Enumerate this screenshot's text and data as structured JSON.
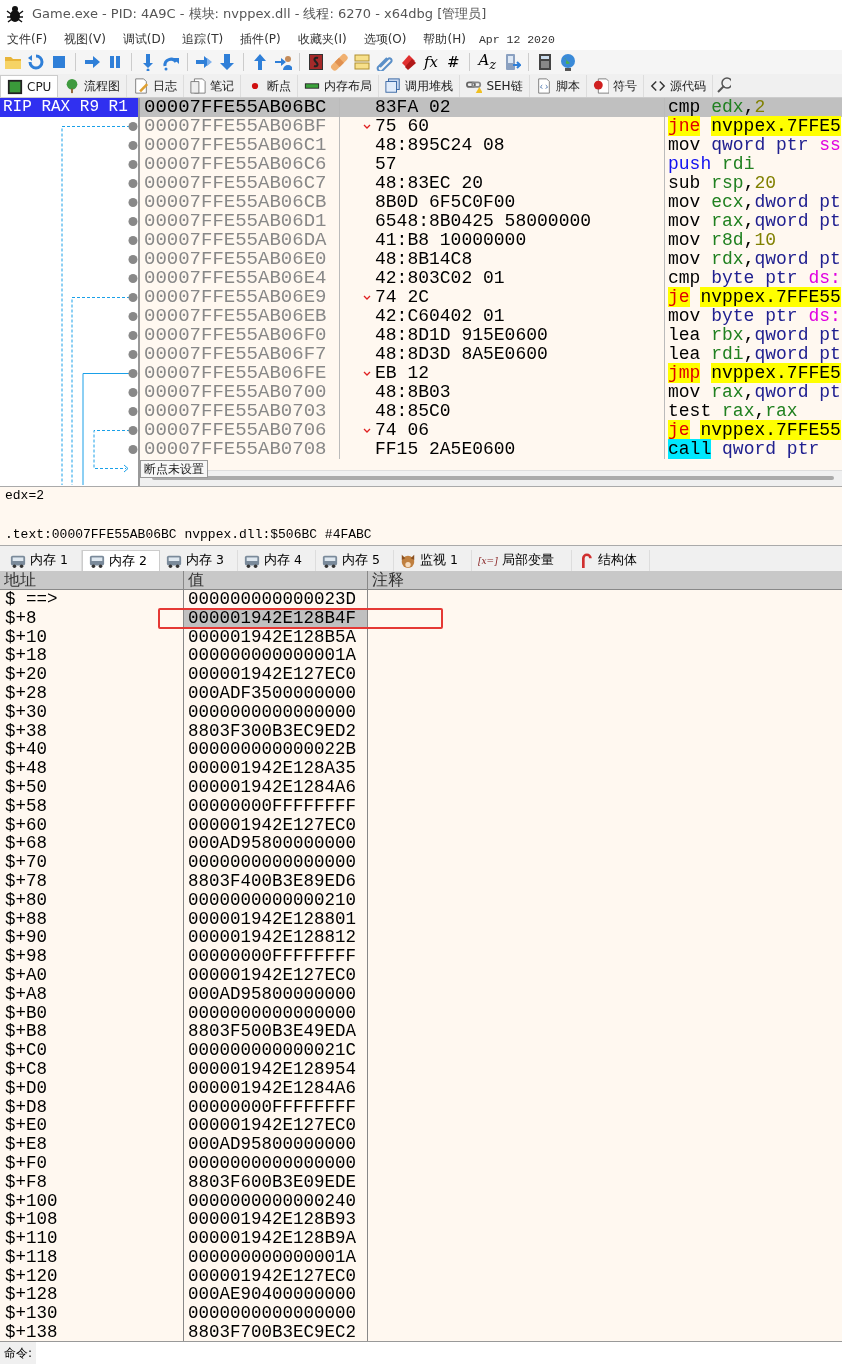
{
  "window": {
    "title": "Game.exe - PID: 4A9C - 模块: nvppex.dll - 线程: 6270 - x64dbg [管理员]"
  },
  "menu": [
    "文件(F)",
    "视图(V)",
    "调试(D)",
    "追踪(T)",
    "插件(P)",
    "收藏夹(I)",
    "选项(O)",
    "帮助(H)"
  ],
  "build_date": "Apr 12 2020",
  "toolbar": [
    {
      "kind": "folder"
    },
    {
      "kind": "restart"
    },
    {
      "kind": "stop"
    },
    {
      "kind": "separator"
    },
    {
      "kind": "run"
    },
    {
      "kind": "pause"
    },
    {
      "kind": "separator"
    },
    {
      "kind": "step-into"
    },
    {
      "kind": "step-over"
    },
    {
      "kind": "separator"
    },
    {
      "kind": "trace-into"
    },
    {
      "kind": "trace-over"
    },
    {
      "kind": "separator"
    },
    {
      "kind": "run-return"
    },
    {
      "kind": "run-user"
    },
    {
      "kind": "separator"
    },
    {
      "kind": "script"
    },
    {
      "kind": "patch"
    },
    {
      "kind": "comment"
    },
    {
      "kind": "link"
    },
    {
      "kind": "bookmark"
    },
    {
      "kind": "glyph",
      "text": "fx"
    },
    {
      "kind": "glyph",
      "text": "#"
    },
    {
      "kind": "separator"
    },
    {
      "kind": "glyph",
      "text": "A$_{z}$"
    },
    {
      "kind": "device"
    },
    {
      "kind": "separator"
    },
    {
      "kind": "calculator"
    },
    {
      "kind": "globe"
    }
  ],
  "tabs": [
    {
      "label": "CPU",
      "kind": "chip",
      "selected": true
    },
    {
      "label": "流程图",
      "kind": "tree",
      "selected": false
    },
    {
      "label": "日志",
      "kind": "log",
      "selected": false
    },
    {
      "label": "笔记",
      "kind": "notes",
      "selected": false
    },
    {
      "label": "断点",
      "kind": "dot",
      "selected": false
    },
    {
      "label": "内存布局",
      "kind": "ram",
      "selected": false
    },
    {
      "label": "调用堆栈",
      "kind": "stack",
      "selected": false
    },
    {
      "label": "SEH链",
      "kind": "chain",
      "selected": false
    },
    {
      "label": "脚本",
      "kind": "script",
      "selected": false
    },
    {
      "label": "符号",
      "kind": "symbol",
      "selected": false
    },
    {
      "label": "源代码",
      "kind": "code",
      "selected": false
    }
  ],
  "registers_header": "RIP RAX R9 R1",
  "disassembly": [
    {
      "address": "00007FFE55AB06BC",
      "bytes": "83FA 02",
      "branch": false,
      "selected": true,
      "mnemonic": "cmp",
      "kind": "plain",
      "operands": [
        {
          "text": "edx",
          "kind": "reg"
        },
        {
          "text": ",",
          "kind": "plain"
        },
        {
          "text": "2",
          "kind": "num"
        }
      ]
    },
    {
      "address": "00007FFE55AB06BF",
      "bytes": "75 60",
      "branch": true,
      "selected": false,
      "mnemonic": "jne",
      "kind": "jump",
      "operands": [
        {
          "text": "nvppex.7FFE5",
          "kind": "target"
        }
      ]
    },
    {
      "address": "00007FFE55AB06C1",
      "bytes": "48:895C24 08",
      "branch": false,
      "selected": false,
      "mnemonic": "mov",
      "kind": "plain",
      "operands": [
        {
          "text": "qword ptr ",
          "kind": "size"
        },
        {
          "text": "ss",
          "kind": "seg"
        }
      ]
    },
    {
      "address": "00007FFE55AB06C6",
      "bytes": "57",
      "branch": false,
      "selected": false,
      "mnemonic": "push",
      "kind": "push",
      "operands": [
        {
          "text": "rdi",
          "kind": "reg"
        }
      ]
    },
    {
      "address": "00007FFE55AB06C7",
      "bytes": "48:83EC 20",
      "branch": false,
      "selected": false,
      "mnemonic": "sub",
      "kind": "plain",
      "operands": [
        {
          "text": "rsp",
          "kind": "reg"
        },
        {
          "text": ",",
          "kind": "plain"
        },
        {
          "text": "20",
          "kind": "num"
        }
      ]
    },
    {
      "address": "00007FFE55AB06CB",
      "bytes": "8B0D 6F5C0F00",
      "branch": false,
      "selected": false,
      "mnemonic": "mov",
      "kind": "plain",
      "operands": [
        {
          "text": "ecx",
          "kind": "reg"
        },
        {
          "text": ",",
          "kind": "plain"
        },
        {
          "text": "dword pt",
          "kind": "size"
        }
      ]
    },
    {
      "address": "00007FFE55AB06D1",
      "bytes": "6548:8B0425 58000000",
      "branch": false,
      "selected": false,
      "mnemonic": "mov",
      "kind": "plain",
      "operands": [
        {
          "text": "rax",
          "kind": "reg"
        },
        {
          "text": ",",
          "kind": "plain"
        },
        {
          "text": "qword pt",
          "kind": "size"
        }
      ]
    },
    {
      "address": "00007FFE55AB06DA",
      "bytes": "41:B8 10000000",
      "branch": false,
      "selected": false,
      "mnemonic": "mov",
      "kind": "plain",
      "operands": [
        {
          "text": "r8d",
          "kind": "reg"
        },
        {
          "text": ",",
          "kind": "plain"
        },
        {
          "text": "10",
          "kind": "num"
        }
      ]
    },
    {
      "address": "00007FFE55AB06E0",
      "bytes": "48:8B14C8",
      "branch": false,
      "selected": false,
      "mnemonic": "mov",
      "kind": "plain",
      "operands": [
        {
          "text": "rdx",
          "kind": "reg"
        },
        {
          "text": ",",
          "kind": "plain"
        },
        {
          "text": "qword pt",
          "kind": "size"
        }
      ]
    },
    {
      "address": "00007FFE55AB06E4",
      "bytes": "42:803C02 01",
      "branch": false,
      "selected": false,
      "mnemonic": "cmp",
      "kind": "plain",
      "operands": [
        {
          "text": "byte ptr ",
          "kind": "size"
        },
        {
          "text": "ds:",
          "kind": "seg"
        }
      ]
    },
    {
      "address": "00007FFE55AB06E9",
      "bytes": "74 2C",
      "branch": true,
      "selected": false,
      "mnemonic": "je",
      "kind": "jump",
      "operands": [
        {
          "text": "nvppex.7FFE55",
          "kind": "target"
        }
      ]
    },
    {
      "address": "00007FFE55AB06EB",
      "bytes": "42:C60402 01",
      "branch": false,
      "selected": false,
      "mnemonic": "mov",
      "kind": "plain",
      "operands": [
        {
          "text": "byte ptr ",
          "kind": "size"
        },
        {
          "text": "ds:",
          "kind": "seg"
        }
      ]
    },
    {
      "address": "00007FFE55AB06F0",
      "bytes": "48:8D1D 915E0600",
      "branch": false,
      "selected": false,
      "mnemonic": "lea",
      "kind": "plain",
      "operands": [
        {
          "text": "rbx",
          "kind": "reg"
        },
        {
          "text": ",",
          "kind": "plain"
        },
        {
          "text": "qword pt",
          "kind": "size"
        }
      ]
    },
    {
      "address": "00007FFE55AB06F7",
      "bytes": "48:8D3D 8A5E0600",
      "branch": false,
      "selected": false,
      "mnemonic": "lea",
      "kind": "plain",
      "operands": [
        {
          "text": "rdi",
          "kind": "reg"
        },
        {
          "text": ",",
          "kind": "plain"
        },
        {
          "text": "qword pt",
          "kind": "size"
        }
      ]
    },
    {
      "address": "00007FFE55AB06FE",
      "bytes": "EB 12",
      "branch": true,
      "selected": false,
      "mnemonic": "jmp",
      "kind": "jump",
      "operands": [
        {
          "text": "nvppex.7FFE5",
          "kind": "target"
        }
      ]
    },
    {
      "address": "00007FFE55AB0700",
      "bytes": "48:8B03",
      "branch": false,
      "selected": false,
      "mnemonic": "mov",
      "kind": "plain",
      "operands": [
        {
          "text": "rax",
          "kind": "reg"
        },
        {
          "text": ",",
          "kind": "plain"
        },
        {
          "text": "qword pt",
          "kind": "size"
        }
      ]
    },
    {
      "address": "00007FFE55AB0703",
      "bytes": "48:85C0",
      "branch": false,
      "selected": false,
      "mnemonic": "test",
      "kind": "plain",
      "operands": [
        {
          "text": "rax",
          "kind": "reg"
        },
        {
          "text": ",",
          "kind": "plain"
        },
        {
          "text": "rax",
          "kind": "reg"
        }
      ]
    },
    {
      "address": "00007FFE55AB0706",
      "bytes": "74 06",
      "branch": true,
      "selected": false,
      "mnemonic": "je",
      "kind": "jump",
      "operands": [
        {
          "text": "nvppex.7FFE55",
          "kind": "target"
        }
      ]
    },
    {
      "address": "00007FFE55AB0708",
      "bytes": "FF15 2A5E0600",
      "branch": false,
      "selected": false,
      "mnemonic": "call",
      "kind": "call",
      "operands": [
        {
          "text": "qword ptr",
          "kind": "size"
        }
      ]
    }
  ],
  "tooltip": "断点未设置",
  "info_lines": [
    "edx=2",
    ".text:00007FFE55AB06BC nvppex.dll:$506BC #4FABC"
  ],
  "dump_tabs": [
    {
      "label": "内存 1",
      "kind": "bus",
      "selected": false
    },
    {
      "label": "内存 2",
      "kind": "bus",
      "selected": true
    },
    {
      "label": "内存 3",
      "kind": "bus",
      "selected": false
    },
    {
      "label": "内存 4",
      "kind": "bus",
      "selected": false
    },
    {
      "label": "内存 5",
      "kind": "bus",
      "selected": false
    },
    {
      "label": "监视 1",
      "kind": "dog",
      "selected": false
    },
    {
      "label": "局部变量",
      "kind": "var",
      "icon_text": "[x=]",
      "selected": false
    },
    {
      "label": "结构体",
      "kind": "cane",
      "selected": false
    }
  ],
  "dump_columns": [
    "地址",
    "值",
    "注释"
  ],
  "dump_rows": [
    {
      "address": "$ ==>",
      "value": "000000000000023D",
      "selected": false
    },
    {
      "address": "$+8",
      "value": "000001942E128B4F",
      "selected": true
    },
    {
      "address": "$+10",
      "value": "000001942E128B5A",
      "selected": false
    },
    {
      "address": "$+18",
      "value": "000000000000001A",
      "selected": false
    },
    {
      "address": "$+20",
      "value": "000001942E127EC0",
      "selected": false
    },
    {
      "address": "$+28",
      "value": "000ADF3500000000",
      "selected": false
    },
    {
      "address": "$+30",
      "value": "0000000000000000",
      "selected": false
    },
    {
      "address": "$+38",
      "value": "8803F300B3EC9ED2",
      "selected": false
    },
    {
      "address": "$+40",
      "value": "000000000000022B",
      "selected": false
    },
    {
      "address": "$+48",
      "value": "000001942E128A35",
      "selected": false
    },
    {
      "address": "$+50",
      "value": "000001942E1284A6",
      "selected": false
    },
    {
      "address": "$+58",
      "value": "00000000FFFFFFFF",
      "selected": false
    },
    {
      "address": "$+60",
      "value": "000001942E127EC0",
      "selected": false
    },
    {
      "address": "$+68",
      "value": "000AD95800000000",
      "selected": false
    },
    {
      "address": "$+70",
      "value": "0000000000000000",
      "selected": false
    },
    {
      "address": "$+78",
      "value": "8803F400B3E89ED6",
      "selected": false
    },
    {
      "address": "$+80",
      "value": "0000000000000210",
      "selected": false
    },
    {
      "address": "$+88",
      "value": "000001942E128801",
      "selected": false
    },
    {
      "address": "$+90",
      "value": "000001942E128812",
      "selected": false
    },
    {
      "address": "$+98",
      "value": "00000000FFFFFFFF",
      "selected": false
    },
    {
      "address": "$+A0",
      "value": "000001942E127EC0",
      "selected": false
    },
    {
      "address": "$+A8",
      "value": "000AD95800000000",
      "selected": false
    },
    {
      "address": "$+B0",
      "value": "0000000000000000",
      "selected": false
    },
    {
      "address": "$+B8",
      "value": "8803F500B3E49EDA",
      "selected": false
    },
    {
      "address": "$+C0",
      "value": "000000000000021C",
      "selected": false
    },
    {
      "address": "$+C8",
      "value": "000001942E128954",
      "selected": false
    },
    {
      "address": "$+D0",
      "value": "000001942E1284A6",
      "selected": false
    },
    {
      "address": "$+D8",
      "value": "00000000FFFFFFFF",
      "selected": false
    },
    {
      "address": "$+E0",
      "value": "000001942E127EC0",
      "selected": false
    },
    {
      "address": "$+E8",
      "value": "000AD95800000000",
      "selected": false
    },
    {
      "address": "$+F0",
      "value": "0000000000000000",
      "selected": false
    },
    {
      "address": "$+F8",
      "value": "8803F600B3E09EDE",
      "selected": false
    },
    {
      "address": "$+100",
      "value": "0000000000000240",
      "selected": false
    },
    {
      "address": "$+108",
      "value": "000001942E128B93",
      "selected": false
    },
    {
      "address": "$+110",
      "value": "000001942E128B9A",
      "selected": false
    },
    {
      "address": "$+118",
      "value": "000000000000001A",
      "selected": false
    },
    {
      "address": "$+120",
      "value": "000001942E127EC0",
      "selected": false
    },
    {
      "address": "$+128",
      "value": "000AE90400000000",
      "selected": false
    },
    {
      "address": "$+130",
      "value": "0000000000000000",
      "selected": false
    },
    {
      "address": "$+138",
      "value": "8803F700B3EC9EC2",
      "selected": false
    }
  ],
  "command": {
    "label": "命令:"
  }
}
